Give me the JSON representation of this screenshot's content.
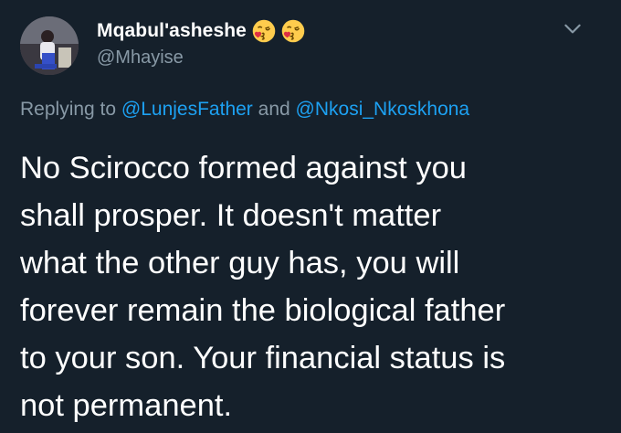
{
  "tweet": {
    "author": {
      "display_name": "Mqabul'asheshe",
      "name_emojis": [
        "kissing-face-heart-emoji",
        "kissing-face-heart-emoji"
      ],
      "handle": "@Mhayise"
    },
    "reply": {
      "prefix": "Replying to",
      "mention_1": "@LunjesFather",
      "conjunction": "and",
      "mention_2": "@Nkosi_Nkoskhona"
    },
    "text_lines": [
      "No Scirocco formed against you",
      "shall prosper. It doesn't matter",
      "what the other guy has, you will",
      "forever remain the biological father",
      "to your son. Your financial status is",
      "not permanent."
    ],
    "menu_icon": "chevron-down-icon"
  },
  "colors": {
    "background": "#15202b",
    "primary_text": "#ffffff",
    "secondary_text": "#8899a6",
    "link": "#1da1f2"
  }
}
